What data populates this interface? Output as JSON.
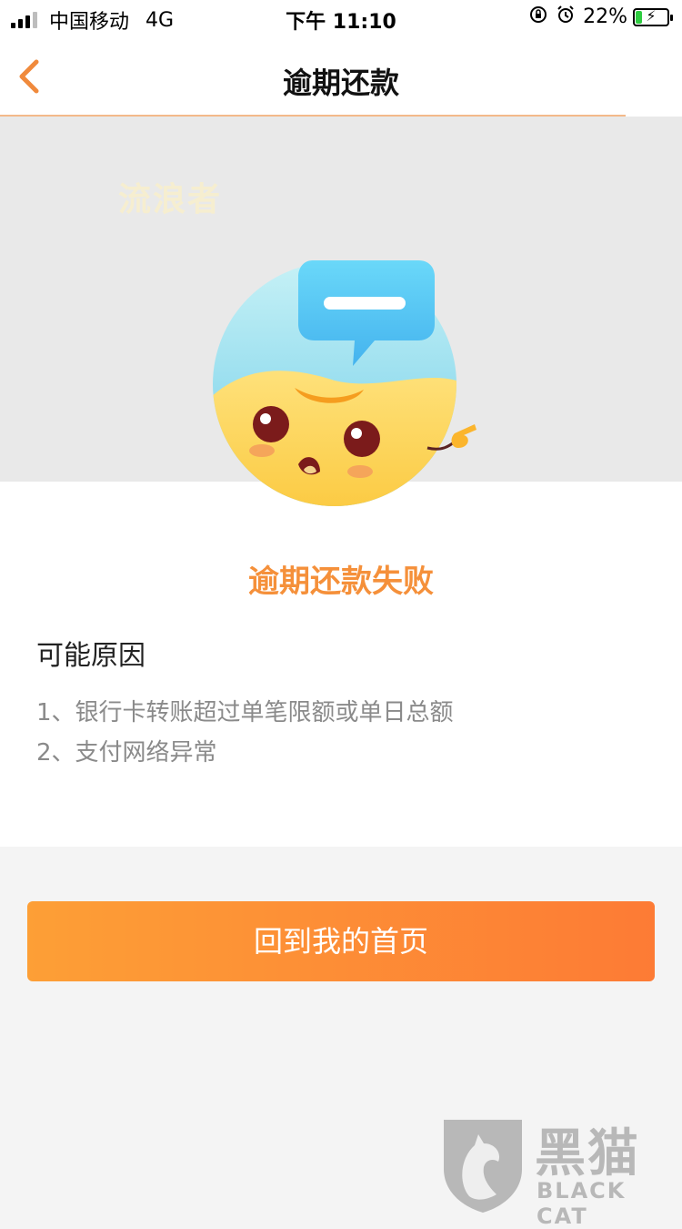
{
  "status_bar": {
    "carrier": "中国移动",
    "network": "4G",
    "time": "下午 11:10",
    "battery_percent_text": "22%",
    "battery_level": 0.22,
    "lock_icon": "orientation-lock-icon",
    "alarm_icon": "alarm-clock-icon"
  },
  "nav": {
    "title": "逾期还款",
    "back_icon": "chevron-left-icon"
  },
  "hero": {
    "user_watermark": "流浪者"
  },
  "result": {
    "title": "逾期还款失败",
    "reasons_heading": "可能原因",
    "reasons": [
      "1、银行卡转账超过单笔限额或单日总额",
      "2、支付网络异常"
    ]
  },
  "actions": {
    "home_button_label": "回到我的首页"
  },
  "brand_watermark": {
    "name": "黑猫",
    "sub": "BLACK CAT"
  },
  "colors": {
    "accent": "#f5903a",
    "button_start": "#fd9f36",
    "button_end": "#fd7b35",
    "back_arrow": "#f08a3c"
  }
}
